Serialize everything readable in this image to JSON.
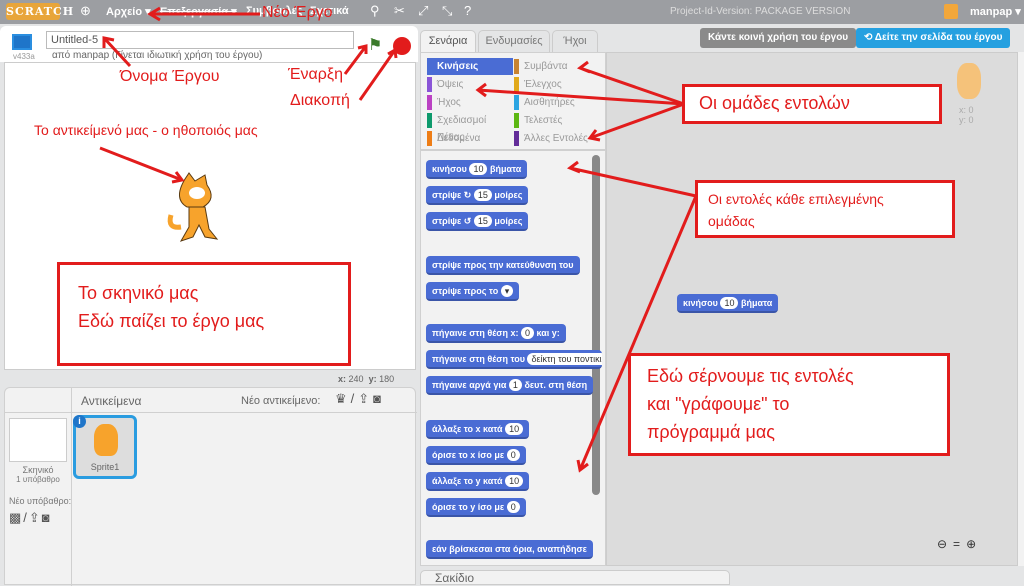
{
  "menubar": {
    "logo": "SCRATCH",
    "file": "Αρχείο ▾",
    "edit": "Επεξεργασία ▾",
    "tips": "Συμβουλές",
    "about": "Σχετικά",
    "version_note": "Project-Id-Version: PACKAGE VERSION",
    "user": "manpap ▾"
  },
  "stage": {
    "version": "v433a",
    "title": "Untitled-5",
    "byline": "από manpap (Γίνεται ιδιωτική χρήση του έργου)",
    "coords_x_label": "x:",
    "coords_x": "240",
    "coords_y_label": "y:",
    "coords_y": "180"
  },
  "sprites": {
    "header": "Αντικείμενα",
    "new_sprite": "Νέο αντικείμενο:",
    "stage_label": "Σκηνικό",
    "backdrops": "1 υπόβαθρο",
    "new_backdrop": "Νέο υπόβαθρο:",
    "sprite1": "Sprite1"
  },
  "tabs": [
    "Σενάρια",
    "Ενδυμασίες",
    "Ήχοι"
  ],
  "buttons": {
    "share": "Κάντε κοινή χρήση του έργου",
    "see_page": "Δείτε την σελίδα του έργου"
  },
  "categories": [
    {
      "label": "Κινήσεις",
      "color": "#4a6cd4"
    },
    {
      "label": "Συμβάντα",
      "color": "#c88330"
    },
    {
      "label": "Όψεις",
      "color": "#8a55d7"
    },
    {
      "label": "Έλεγχος",
      "color": "#e1a91a"
    },
    {
      "label": "Ήχος",
      "color": "#bb42c3"
    },
    {
      "label": "Αισθητήρες",
      "color": "#2ca5e2"
    },
    {
      "label": "Σχεδιασμοί Πένας",
      "color": "#0e9a6c"
    },
    {
      "label": "Τελεστές",
      "color": "#5cb712"
    },
    {
      "label": "Δεδομένα",
      "color": "#ee7d16"
    },
    {
      "label": "Άλλες Εντολές",
      "color": "#632d99"
    }
  ],
  "blocks": [
    {
      "a": "κινήσου",
      "v": "10",
      "b": "βήματα"
    },
    {
      "a": "στρίψε ↻",
      "v": "15",
      "b": "μοίρες"
    },
    {
      "a": "στρίψε ↺",
      "v": "15",
      "b": "μοίρες"
    },
    {
      "a": "στρίψε προς την κατεύθυνση του",
      "v": "",
      "b": ""
    },
    {
      "a": "στρίψε προς το",
      "v": "▾",
      "b": ""
    },
    {
      "a": "πήγαινε στη θέση x:",
      "v": "0",
      "b": "και y:"
    },
    {
      "a": "πήγαινε στη θέση του",
      "v": "δείκτη του ποντικιού",
      "b": ""
    },
    {
      "a": "πήγαινε αργά για",
      "v": "1",
      "b": "δευτ. στη θέση"
    },
    {
      "a": "άλλαξε το x κατά",
      "v": "10",
      "b": ""
    },
    {
      "a": "όρισε το x ίσο με",
      "v": "0",
      "b": ""
    },
    {
      "a": "άλλαξε το y κατά",
      "v": "10",
      "b": ""
    },
    {
      "a": "όρισε το y ίσο με",
      "v": "0",
      "b": ""
    },
    {
      "a": "εάν βρίσκεσαι στα όρια, αναπήδησε",
      "v": "",
      "b": ""
    }
  ],
  "script": {
    "block_a": "κινήσου",
    "block_v": "10",
    "block_b": "βήματα",
    "sprite_x": "x: 0",
    "sprite_y": "y: 0"
  },
  "backpack": "Σακίδιο",
  "annotations": {
    "new_project": "Νέο Έργο",
    "project_name": "Όνομα Έργου",
    "start": "Έναρξη",
    "stop": "Διακοπή",
    "sprite": "Το αντικείμενό μας - ο ηθοποιός μας",
    "stage1": "Το σκηνικό μας",
    "stage2": "Εδώ παίζει το έργο μας",
    "groups": "Οι ομάδες εντολών",
    "cmds1": "Οι εντολές κάθε επιλεγμένης",
    "cmds2": "ομάδας",
    "script1": "Εδώ σέρνουμε τις εντολές",
    "script2": "και \"γράφουμε\" το",
    "script3": "πρόγραμμά μας"
  }
}
